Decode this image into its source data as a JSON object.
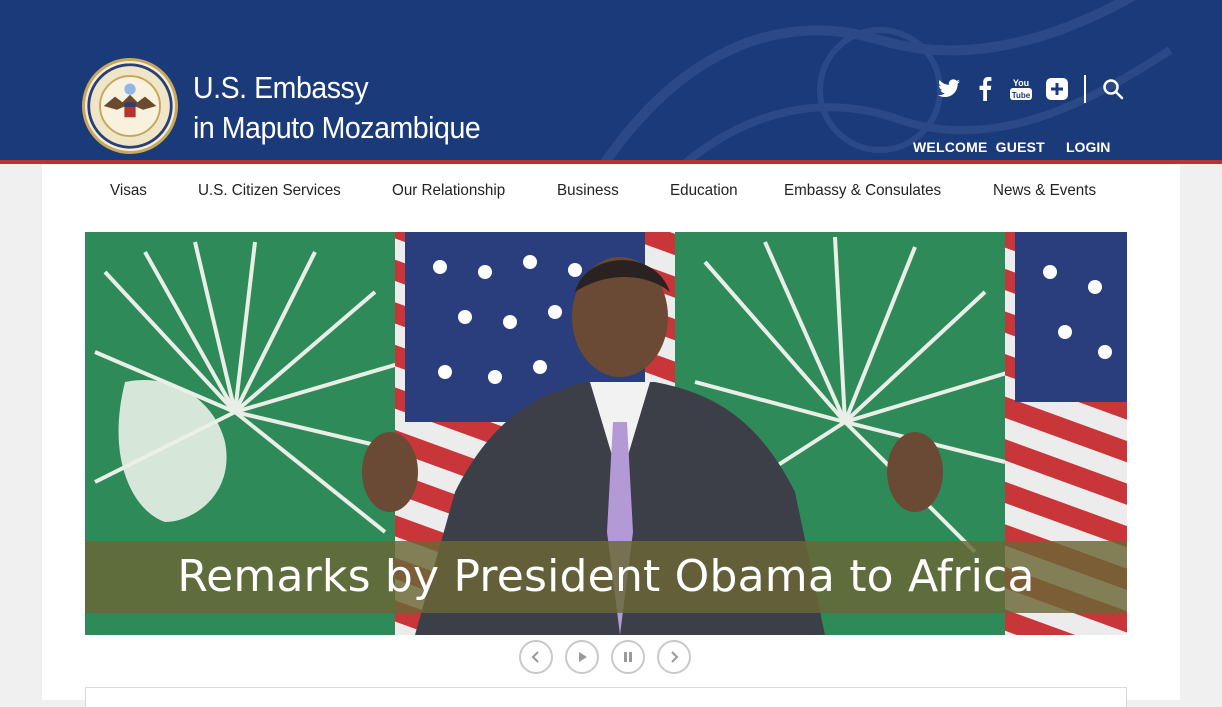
{
  "header": {
    "brand_line1": "U.S. Embassy",
    "brand_line2": "in Maputo Mozambique",
    "social": [
      {
        "name": "twitter-icon"
      },
      {
        "name": "facebook-icon"
      },
      {
        "name": "youtube-icon"
      },
      {
        "name": "plus-icon"
      },
      {
        "name": "search-icon"
      }
    ],
    "welcome": "WELCOME  GUEST",
    "login": "LOGIN"
  },
  "nav": {
    "items": [
      "Visas",
      "U.S. Citizen Services",
      "Our Relationship",
      "Business",
      "Education",
      "Embassy & Consulates",
      "News & Events"
    ]
  },
  "hero": {
    "caption": "Remarks by President Obama to Africa"
  },
  "carousel": {
    "controls": [
      "previous",
      "play",
      "pause",
      "next"
    ]
  },
  "colors": {
    "header_bg": "#1b3a7a",
    "accent_red": "#b8322e",
    "caption_band": "#6a6636"
  }
}
